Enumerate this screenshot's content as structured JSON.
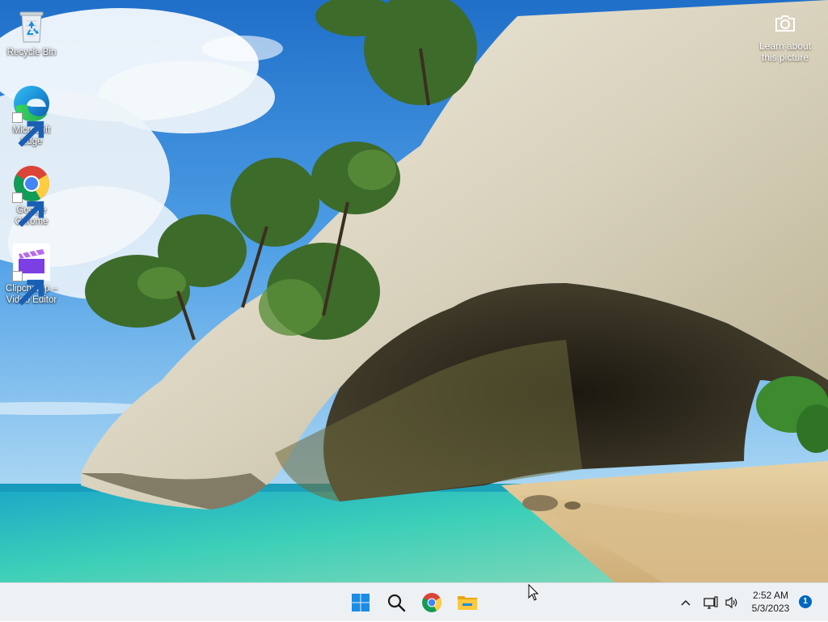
{
  "desktop": {
    "wallpaper": "Cathedral Cove sea arch over turquoise water",
    "icons": [
      {
        "label": "Recycle Bin",
        "icon": "recycle-bin-icon"
      },
      {
        "label": "Microsoft Edge",
        "icon": "edge-icon"
      },
      {
        "label": "Google Chrome",
        "icon": "chrome-icon"
      },
      {
        "label": "Clipchamp – Video Editor",
        "icon": "clipchamp-icon"
      }
    ],
    "learn_picture": {
      "label": "Learn about this picture",
      "icon": "camera-icon"
    }
  },
  "taskbar": {
    "apps": [
      {
        "name": "Start",
        "icon": "windows-start-icon"
      },
      {
        "name": "Search",
        "icon": "search-icon"
      },
      {
        "name": "Google Chrome",
        "icon": "chrome-icon"
      },
      {
        "name": "File Explorer",
        "icon": "file-explorer-icon"
      }
    ],
    "tray": {
      "overflow_icon": "chevron-up-icon",
      "network_icon": "network-icon",
      "volume_icon": "speaker-icon",
      "time": "2:52 AM",
      "date": "5/3/2023",
      "notification_count": "1"
    }
  },
  "colors": {
    "taskbar_bg": "#eef1f4",
    "accent": "#0067c0",
    "windows_blue": "#1a8ce3"
  }
}
